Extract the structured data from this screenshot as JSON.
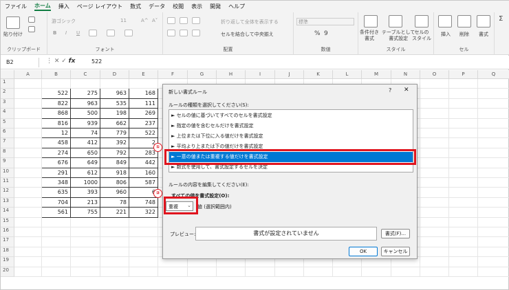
{
  "menu": [
    "ファイル",
    "ホーム",
    "挿入",
    "ページ レイアウト",
    "数式",
    "データ",
    "校閲",
    "表示",
    "開発",
    "ヘルプ"
  ],
  "ribbon": {
    "clipboard": {
      "paste": "貼り付け",
      "label": "クリップボード"
    },
    "font": {
      "name": "游ゴシック",
      "size": "11",
      "bold": "B",
      "italic": "I",
      "underline": "U",
      "grow": "A^",
      "shrink": "A˅",
      "label": "フォント"
    },
    "alignment": {
      "wrap": "折り返して全体を表示する",
      "merge": "セルを結合して中央揃え",
      "label": "配置"
    },
    "number": {
      "format": "標準",
      "percent": "%",
      "comma": "9",
      "label": "数値"
    },
    "styles": {
      "conditional": "条件付き\n書式",
      "table": "テーブルとして\n書式設定",
      "cell": "セルの\nスタイル",
      "label": "スタイル"
    },
    "cells": {
      "insert": "挿入",
      "delete": "削除",
      "format": "書式",
      "label": "セル"
    },
    "editing": {
      "sigma": "Σ"
    }
  },
  "formula_bar": {
    "name_box": "B2",
    "fx": "fx",
    "value": "522"
  },
  "columns": [
    "A",
    "B",
    "C",
    "D",
    "E",
    "F",
    "G",
    "H",
    "I",
    "J",
    "K",
    "L",
    "M",
    "N",
    "O",
    "P",
    "Q"
  ],
  "rows": [
    "1",
    "2",
    "3",
    "4",
    "5",
    "6",
    "7",
    "8",
    "9",
    "10",
    "11",
    "12",
    "13",
    "14",
    "15",
    "16",
    "17",
    "18",
    "19",
    "20"
  ],
  "table": [
    [
      "522",
      "275",
      "963",
      "168"
    ],
    [
      "822",
      "963",
      "535",
      "111"
    ],
    [
      "868",
      "500",
      "198",
      "269"
    ],
    [
      "816",
      "939",
      "662",
      "237"
    ],
    [
      "12",
      "74",
      "779",
      "522"
    ],
    [
      "458",
      "412",
      "392",
      "2"
    ],
    [
      "274",
      "650",
      "792",
      "283"
    ],
    [
      "676",
      "649",
      "849",
      "442"
    ],
    [
      "291",
      "612",
      "918",
      "160"
    ],
    [
      "348",
      "1000",
      "806",
      "587"
    ],
    [
      "635",
      "393",
      "960",
      "6"
    ],
    [
      "704",
      "213",
      "78",
      "748"
    ],
    [
      "561",
      "755",
      "221",
      "322"
    ]
  ],
  "n_column_edge": [
    "0",
    "7",
    "4",
    "7",
    "2",
    "2",
    "2",
    "7",
    "7",
    "2",
    "2",
    "5",
    "5"
  ],
  "dialog": {
    "title": "新しい書式ルール",
    "help": "?",
    "close": "✕",
    "rule_type_label": "ルールの種類を選択してください(S):",
    "rule_types": [
      "► セルの値に基づいてすべてのセルを書式設定",
      "► 指定の値を含むセルだけを書式設定",
      "► 上位または下位に入る値だけを書式設定",
      "► 平均より上または下の値だけを書式設定",
      "► 一意の値または重複する値だけを書式設定",
      "► 数式を使用して、書式設定するセルを決定"
    ],
    "selected_index": 4,
    "edit_label": "ルールの内容を編集してください(E):",
    "format_all_label": "すべての値を書式設定(O):",
    "combo_value": "重複",
    "combo_suffix": "値 (選択範囲内)",
    "preview_label": "プレビュー:",
    "preview_text": "書式が設定されていません",
    "format_button": "書式(F)...",
    "ok_button": "OK",
    "cancel_button": "キャンセル"
  },
  "badges": [
    "①",
    "②"
  ],
  "accent": "#107c41",
  "highlight_color": "#e0141e",
  "selection_color": "#0078d4"
}
